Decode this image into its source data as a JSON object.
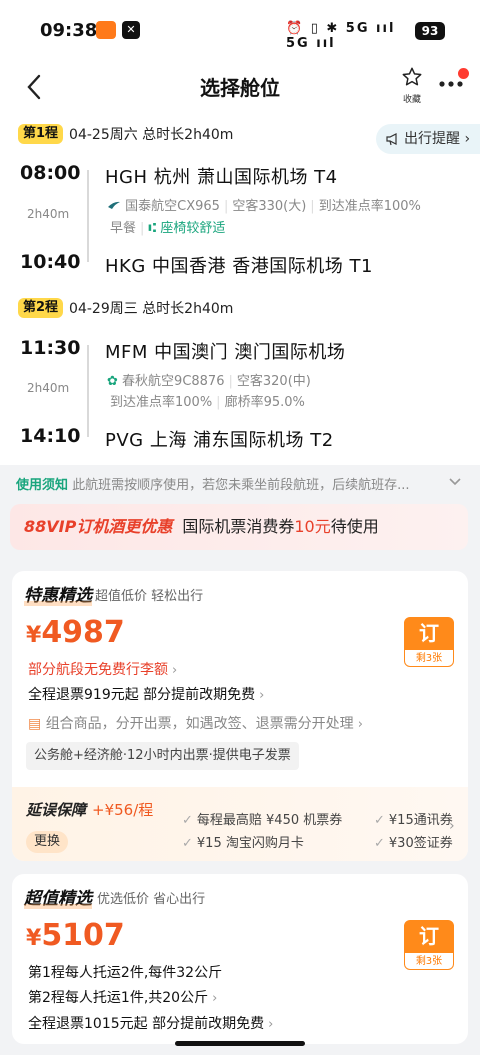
{
  "status_bar": {
    "time": "09:38",
    "app2_glyph": "✕",
    "icons_text": "⏰ ▯ ✱ 5G ııl 5G ııl",
    "battery": "93"
  },
  "nav": {
    "title": "选择舱位",
    "fav_label": "收藏",
    "back_icon": "chevron-left-icon",
    "more_icon": "more-dots-icon"
  },
  "reminder": {
    "label": "出行提醒",
    "chevron": "›"
  },
  "legs": [
    {
      "tag": "第1程",
      "info": "04-25周六  总时长2h40m",
      "dep_time": "08:00",
      "duration": "2h40m",
      "arr_time": "10:40",
      "dep_airport": "HGH  杭州  萧山国际机场  T4",
      "arr_airport": "HKG  中国香港  香港国际机场  T1",
      "airline": "国泰航空CX965",
      "aircraft": "空客330(大)",
      "ontime": "到达准点率100%",
      "meal": "早餐",
      "comfort": "座椅较舒适"
    },
    {
      "tag": "第2程",
      "info": "04-29周三  总时长2h40m",
      "dep_time": "11:30",
      "duration": "2h40m",
      "arr_time": "14:10",
      "dep_airport": "MFM  中国澳门  澳门国际机场",
      "arr_airport": "PVG  上海  浦东国际机场  T2",
      "airline": "春秋航空9C8876",
      "aircraft": "空客320(中)",
      "ontime": "到达准点率100%",
      "bridge": "廊桥率95.0%"
    }
  ],
  "notice": {
    "key": "使用须知",
    "text": "此航班需按顺序使用，若您未乘坐前段航班，后续航班存..."
  },
  "vip": {
    "brand": "88VIP订机酒更优惠",
    "text_pre": "国际机票消费券",
    "amount": "10元",
    "text_post": "待使用"
  },
  "cards": [
    {
      "title": "特惠精选",
      "subtitle": "超值低价 轻松出行",
      "currency": "¥",
      "price": "4987",
      "book_label": "订",
      "remaining": "剩3张",
      "baggage": "部分航段无免费行李额",
      "refund": "全程退票919元起 部分提前改期免费",
      "combo": "组合商品，分开出票，如遇改签、退票需分开处理",
      "tags": "公务舱+经济舱·12小时内出票·提供电子发票",
      "promo": {
        "title": "延误保障",
        "price": "+¥56/程",
        "change": "更换",
        "items": [
          "每程最高赔 ¥450 机票券",
          "¥15通讯券",
          "¥15 淘宝闪购月卡",
          "¥30签证券"
        ]
      }
    },
    {
      "title": "超值精选",
      "subtitle": "优选低价 省心出行",
      "currency": "¥",
      "price": "5107",
      "book_label": "订",
      "remaining": "剩3张",
      "baggage_leg1": "第1程每人托运2件,每件32公斤",
      "baggage_leg2": "第2程每人托运1件,共20公斤",
      "refund": "全程退票1015元起 部分提前改期免费"
    }
  ]
}
